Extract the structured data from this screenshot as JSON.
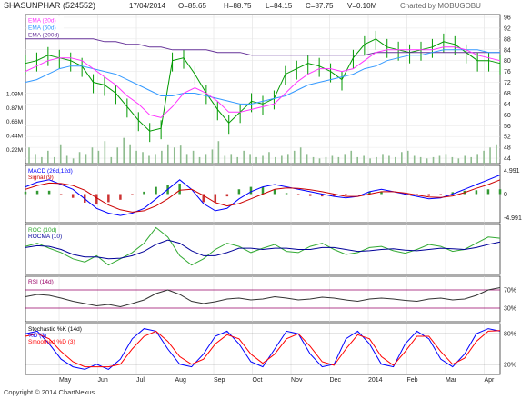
{
  "header": {
    "symbol": "SHASUNPHAR (524552)",
    "date": "17/04/2014",
    "open": "O=85.65",
    "high": "H=88.75",
    "low": "L=84.15",
    "close": "C=87.75",
    "volume": "V=0.10M",
    "charted_by": "Charted by MOBUGOBU",
    "copyright": "Copyright © 2014 ChartNexus"
  },
  "colors": {
    "price_bar": "#009900",
    "ema20": "#ff33ff",
    "ema50": "#3399ff",
    "ema200": "#663399",
    "macd": "#0000ff",
    "signal": "#cc0000",
    "hist_pos": "#339933",
    "hist_neg": "#cc3333",
    "roc": "#33aa33",
    "rocma": "#000099",
    "rsi": "#333333",
    "rsi_band": "#990066",
    "stoch_k": "#0000ff",
    "stoch_d": "#ff0000",
    "volume": "#8fbc8f"
  },
  "chart_data": [
    {
      "type": "line",
      "panel": "price",
      "legend": [
        "EMA (20d)",
        "EMA (50d)",
        "EMA (200d)"
      ],
      "y_ticks": [
        "96",
        "92",
        "88",
        "84",
        "80",
        "76",
        "72",
        "68",
        "64",
        "60",
        "56",
        "52",
        "48",
        "44"
      ],
      "ylim": [
        42,
        97
      ],
      "x_labels": [
        "May",
        "Jun",
        "Jul",
        "Aug",
        "Sep",
        "Oct",
        "Nov",
        "Dec",
        "2014",
        "Feb",
        "Mar",
        "Apr"
      ],
      "series": [
        {
          "name": "Price",
          "style": "ohlc",
          "x": [
            0,
            6,
            12,
            18,
            24,
            30,
            36,
            42,
            48,
            54,
            60,
            66,
            72,
            78,
            84,
            90,
            96,
            102,
            108,
            114,
            120,
            126,
            132,
            138,
            144,
            150,
            156,
            162,
            168,
            174,
            180,
            186,
            192,
            198,
            204,
            210,
            216,
            222,
            228,
            234,
            240,
            246,
            252
          ],
          "values": [
            79,
            80,
            82,
            81,
            80,
            78,
            72,
            71,
            68,
            63,
            58,
            54,
            55,
            80,
            81,
            75,
            68,
            62,
            57,
            61,
            65,
            64,
            66,
            75,
            77,
            79,
            78,
            76,
            73,
            81,
            86,
            88,
            85,
            84,
            83,
            84,
            85,
            87,
            86,
            83,
            80,
            80,
            79
          ]
        },
        {
          "name": "EMA (20d)",
          "x": [
            0,
            6,
            12,
            18,
            24,
            30,
            36,
            42,
            48,
            54,
            60,
            66,
            72,
            78,
            84,
            90,
            96,
            102,
            108,
            114,
            120,
            126,
            132,
            138,
            144,
            150,
            156,
            162,
            168,
            174,
            180,
            186,
            192,
            198,
            204,
            210,
            216,
            222,
            228,
            234,
            240,
            246,
            252
          ],
          "values": [
            76,
            78,
            80,
            81,
            81,
            80,
            77,
            74,
            71,
            67,
            64,
            60,
            59,
            63,
            68,
            70,
            68,
            65,
            61,
            61,
            62,
            63,
            64,
            68,
            72,
            75,
            77,
            77,
            76,
            77,
            80,
            83,
            84,
            84,
            84,
            84,
            84,
            85,
            85,
            84,
            82,
            81,
            80
          ]
        },
        {
          "name": "EMA (50d)",
          "x": [
            0,
            6,
            12,
            18,
            24,
            30,
            36,
            42,
            48,
            54,
            60,
            66,
            72,
            78,
            84,
            90,
            96,
            102,
            108,
            114,
            120,
            126,
            132,
            138,
            144,
            150,
            156,
            162,
            168,
            174,
            180,
            186,
            192,
            198,
            204,
            210,
            216,
            222,
            228,
            234,
            240,
            246,
            252
          ],
          "values": [
            72,
            73,
            75,
            77,
            78,
            78,
            77,
            76,
            75,
            73,
            71,
            69,
            67,
            67,
            68,
            68,
            67,
            66,
            65,
            64,
            64,
            65,
            66,
            67,
            69,
            71,
            72,
            73,
            74,
            75,
            77,
            78,
            80,
            81,
            82,
            82,
            83,
            84,
            84,
            84,
            84,
            83,
            83
          ]
        },
        {
          "name": "EMA (200d)",
          "x": [
            0,
            6,
            12,
            18,
            24,
            30,
            36,
            42,
            48,
            54,
            60,
            66,
            72,
            78,
            84,
            90,
            96,
            102,
            108,
            114,
            120,
            126,
            132,
            138,
            144,
            150,
            156,
            162,
            168,
            174,
            180,
            186,
            192,
            198,
            204,
            210,
            216,
            222,
            228,
            234,
            240,
            246,
            252
          ],
          "values": [
            88,
            88,
            88,
            88,
            88,
            88,
            88,
            87,
            87,
            86,
            86,
            85,
            85,
            84,
            84,
            84,
            84,
            83,
            83,
            83,
            82,
            82,
            82,
            82,
            82,
            82,
            82,
            82,
            82,
            82,
            82,
            83,
            83,
            83,
            83,
            83,
            83,
            83,
            83,
            83,
            83,
            83,
            83
          ]
        }
      ]
    },
    {
      "type": "bar",
      "panel": "volume",
      "y_ticks": [
        "1.09M",
        "0.87M",
        "0.66M",
        "0.44M",
        "0.22M"
      ],
      "ylim": [
        0,
        1.2
      ],
      "values": [
        0.25,
        0.15,
        0.1,
        0.2,
        0.1,
        0.3,
        0.12,
        0.08,
        0.18,
        0.15,
        0.25,
        0.2,
        0.35,
        0.1,
        0.25,
        0.4,
        0.3,
        0.2,
        0.18,
        0.12,
        0.15,
        0.2,
        0.3,
        0.25,
        0.28,
        0.15,
        0.2,
        0.1,
        0.15,
        0.22,
        0.35,
        0.12,
        0.15,
        0.1,
        0.2,
        0.15,
        0.1,
        0.12,
        0.18,
        0.1,
        0.12,
        0.15,
        0.2,
        0.25,
        0.15,
        0.1,
        0.08,
        0.1,
        0.12,
        0.1,
        0.15,
        0.2,
        0.1,
        0.12,
        0.08,
        0.1,
        0.15,
        0.12,
        0.1,
        0.18,
        0.2,
        0.12,
        0.1,
        0.08,
        0.1,
        0.12,
        0.15,
        0.1,
        0.08,
        0.12,
        0.1,
        0.15,
        0.2,
        0.25,
        0.3
      ]
    },
    {
      "type": "line",
      "panel": "macd",
      "legend": [
        "MACD (26d,12d)",
        "Signal (9)"
      ],
      "y_ticks": [
        "4.991",
        "0",
        "-4.991"
      ],
      "ylim": [
        -6,
        6
      ],
      "series": [
        {
          "name": "MACD (26d,12d)",
          "values": [
            1.5,
            2.5,
            3,
            2,
            1,
            -1,
            -3,
            -4,
            -4.5,
            -4,
            -3,
            -1,
            1,
            3,
            1,
            -2,
            -3.5,
            -3,
            -1,
            0.5,
            1.5,
            2,
            1.5,
            1,
            0.5,
            0,
            -0.5,
            -0.8,
            -0.5,
            0.5,
            1,
            0.5,
            0,
            -0.5,
            -1,
            -0.8,
            0,
            1,
            2,
            3,
            4
          ]
        },
        {
          "name": "Signal (9)",
          "values": [
            1,
            1.8,
            2.3,
            2.2,
            1.8,
            0.8,
            -0.8,
            -2.3,
            -3.3,
            -3.8,
            -3.5,
            -2.5,
            -1,
            0.8,
            1,
            -0.3,
            -1.8,
            -2.5,
            -2,
            -1,
            0,
            1,
            1.3,
            1.2,
            0.9,
            0.5,
            0,
            -0.5,
            -0.5,
            0,
            0.5,
            0.5,
            0.2,
            -0.2,
            -0.6,
            -0.7,
            -0.4,
            0.3,
            1.2,
            2,
            3
          ]
        }
      ]
    },
    {
      "type": "line",
      "panel": "roc",
      "legend": [
        "ROC (10d)",
        "ROCMA (10)"
      ],
      "ylim": [
        -40,
        40
      ],
      "series": [
        {
          "name": "ROC (10d)",
          "values": [
            5,
            10,
            2,
            -5,
            -15,
            -20,
            -10,
            -25,
            -15,
            -5,
            10,
            35,
            20,
            -10,
            -25,
            -15,
            0,
            10,
            5,
            -5,
            2,
            8,
            -3,
            -5,
            5,
            10,
            0,
            -8,
            -5,
            3,
            5,
            -2,
            -6,
            0,
            8,
            5,
            -3,
            0,
            10,
            20,
            18
          ]
        },
        {
          "name": "ROCMA (10)",
          "values": [
            3,
            6,
            5,
            0,
            -8,
            -12,
            -12,
            -15,
            -14,
            -10,
            -3,
            8,
            15,
            10,
            -2,
            -10,
            -10,
            -5,
            2,
            2,
            0,
            2,
            2,
            0,
            0,
            3,
            3,
            0,
            -3,
            -2,
            0,
            1,
            -1,
            -2,
            0,
            2,
            1,
            0,
            3,
            8,
            12
          ]
        }
      ]
    },
    {
      "type": "line",
      "panel": "rsi",
      "legend": [
        "RSI (14d)"
      ],
      "y_ticks": [
        "70%",
        "30%"
      ],
      "ylim": [
        0,
        100
      ],
      "series": [
        {
          "name": "RSI (14d)",
          "values": [
            55,
            60,
            58,
            52,
            45,
            40,
            35,
            38,
            33,
            40,
            48,
            62,
            70,
            60,
            45,
            40,
            44,
            50,
            52,
            48,
            50,
            55,
            52,
            48,
            50,
            54,
            52,
            48,
            45,
            50,
            52,
            50,
            47,
            45,
            50,
            52,
            48,
            50,
            58,
            70,
            75
          ]
        }
      ]
    },
    {
      "type": "line",
      "panel": "stochastic",
      "legend": [
        "Stochastic %K (14d)",
        "%D (3)",
        "Smoothed %D (3)"
      ],
      "y_ticks": [
        "80%",
        "20%"
      ],
      "ylim": [
        0,
        100
      ],
      "series": [
        {
          "name": "Stochastic %K (14d)",
          "values": [
            80,
            85,
            60,
            30,
            15,
            10,
            20,
            10,
            30,
            70,
            90,
            85,
            50,
            20,
            15,
            40,
            75,
            85,
            60,
            25,
            15,
            50,
            85,
            80,
            40,
            15,
            20,
            70,
            85,
            60,
            20,
            15,
            60,
            85,
            70,
            30,
            15,
            40,
            80,
            90,
            85
          ]
        },
        {
          "name": "%D (3)",
          "values": [
            75,
            80,
            70,
            45,
            25,
            15,
            15,
            15,
            20,
            50,
            75,
            85,
            65,
            35,
            20,
            30,
            60,
            78,
            70,
            40,
            22,
            40,
            70,
            80,
            55,
            25,
            18,
            50,
            78,
            70,
            35,
            18,
            45,
            75,
            75,
            45,
            20,
            32,
            65,
            85,
            86
          ]
        }
      ]
    }
  ],
  "axis_labels": [
    "May",
    "Jun",
    "Jul",
    "Aug",
    "Sep",
    "Oct",
    "Nov",
    "Dec",
    "2014",
    "Feb",
    "Mar",
    "Apr"
  ]
}
